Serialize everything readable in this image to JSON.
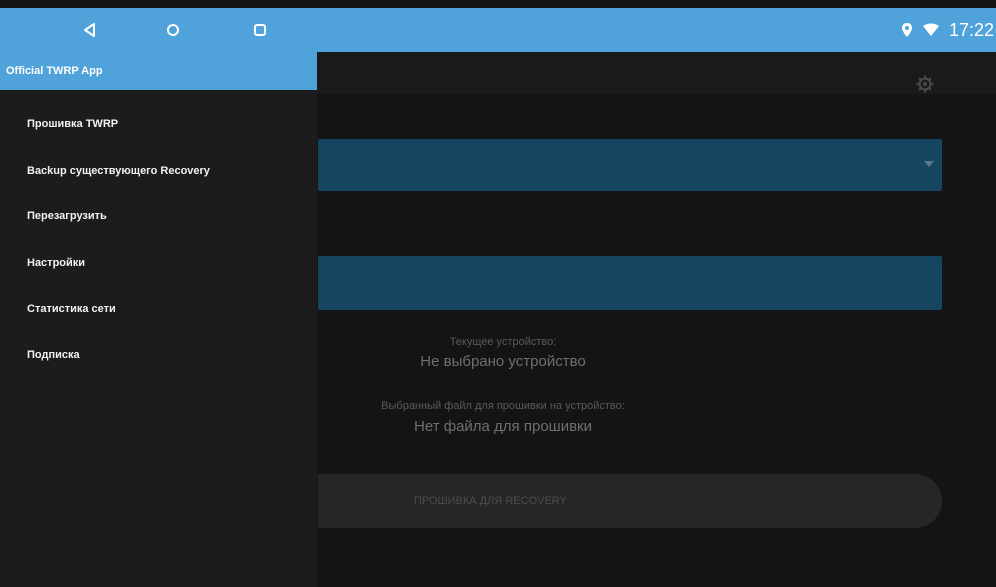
{
  "status_bar": {
    "time": "17:22",
    "nav": {
      "back_icon": "back-triangle-icon",
      "home_icon": "home-circle-icon",
      "recents_icon": "recents-square-icon"
    },
    "icons": [
      "location-pin-icon",
      "wifi-icon"
    ],
    "color": "#4fa3da"
  },
  "drawer": {
    "title": "Official TWRP App",
    "items": [
      {
        "label": "Прошивка TWRP"
      },
      {
        "label": "Backup существующего Recovery"
      },
      {
        "label": "Перезагрузить"
      },
      {
        "label": "Настройки"
      },
      {
        "label": "Статистика сети"
      },
      {
        "label": "Подписка"
      }
    ]
  },
  "main": {
    "settings_icon": "gear-icon",
    "current_device_label": "Текущее устройство:",
    "current_device_value": "Не выбрано устройство",
    "selected_file_label": "Выбранный файл для прошивки на устройство:",
    "selected_file_value": "Нет файла для прошивки",
    "flash_button_label": "ПРОШИВКА ДЛЯ RECOVERY"
  },
  "colors": {
    "accent": "#4fa3da",
    "field": "#16465f",
    "drawer_bg": "#1c1c1c",
    "main_bg": "#141414"
  }
}
